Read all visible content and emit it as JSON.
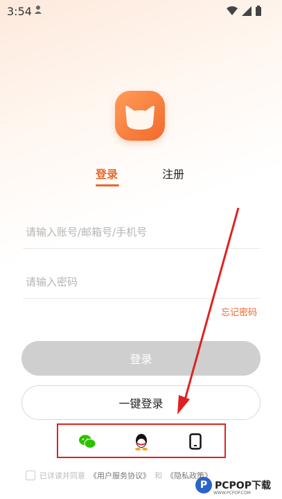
{
  "status_bar": {
    "time": "3:54"
  },
  "tabs": {
    "login": "登录",
    "register": "注册"
  },
  "fields": {
    "account_placeholder": "请输入账号/邮箱号/手机号",
    "password_placeholder": "请输入密码"
  },
  "forgot_password": "忘记密码",
  "buttons": {
    "login": "登录",
    "one_key_login": "一键登录"
  },
  "social_login": [
    "wechat-icon",
    "qq-icon",
    "phone-icon"
  ],
  "agreement": {
    "prefix": "已详读并同意",
    "user_agreement": "《用户服务协议》",
    "and": "和",
    "privacy": "《隐私政策》"
  },
  "watermark": {
    "logo": "P",
    "text": "PCPOP下载",
    "sub": "WWW.PCPOP.COM"
  },
  "colors": {
    "accent": "#e8672b",
    "highlight_box": "#e02020",
    "disabled_button": "#cfcfcf"
  }
}
